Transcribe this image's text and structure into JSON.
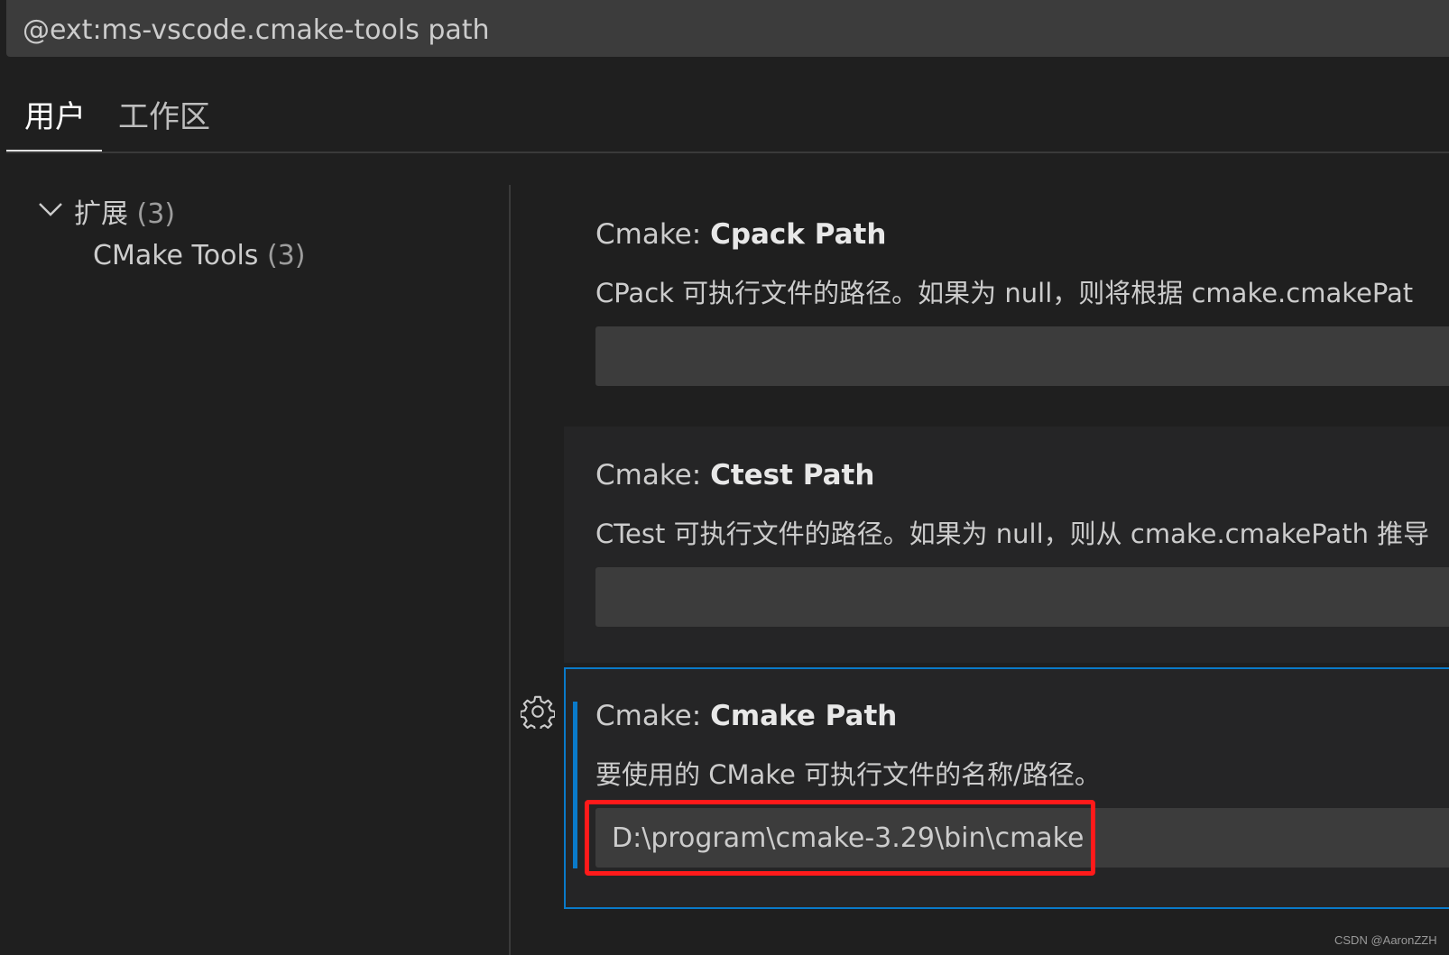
{
  "search": {
    "value": "@ext:ms-vscode.cmake-tools path"
  },
  "tabs": [
    {
      "label": "用户"
    },
    {
      "label": "工作区"
    }
  ],
  "toc": {
    "group": {
      "label": "扩展",
      "count": "(3)"
    },
    "child": {
      "label": "CMake Tools",
      "count": "(3)"
    }
  },
  "settings": [
    {
      "prefix": "Cmake: ",
      "name": "Cpack Path",
      "description": "CPack 可执行文件的路径。如果为 null，则将根据 cmake.cmakePat",
      "value": ""
    },
    {
      "prefix": "Cmake: ",
      "name": "Ctest Path",
      "description": "CTest 可执行文件的路径。如果为 null，则从 cmake.cmakePath 推导",
      "value": ""
    },
    {
      "prefix": "Cmake: ",
      "name": "Cmake Path",
      "description": "要使用的 CMake 可执行文件的名称/路径。",
      "value": "D:\\program\\cmake-3.29\\bin\\cmake"
    }
  ],
  "watermark": "CSDN @AaronZZH",
  "colors": {
    "background": "#1f1f1f",
    "input_background": "#3c3c3c",
    "focus_border": "#0a7ac9",
    "highlight_box": "#ff1a1a"
  }
}
